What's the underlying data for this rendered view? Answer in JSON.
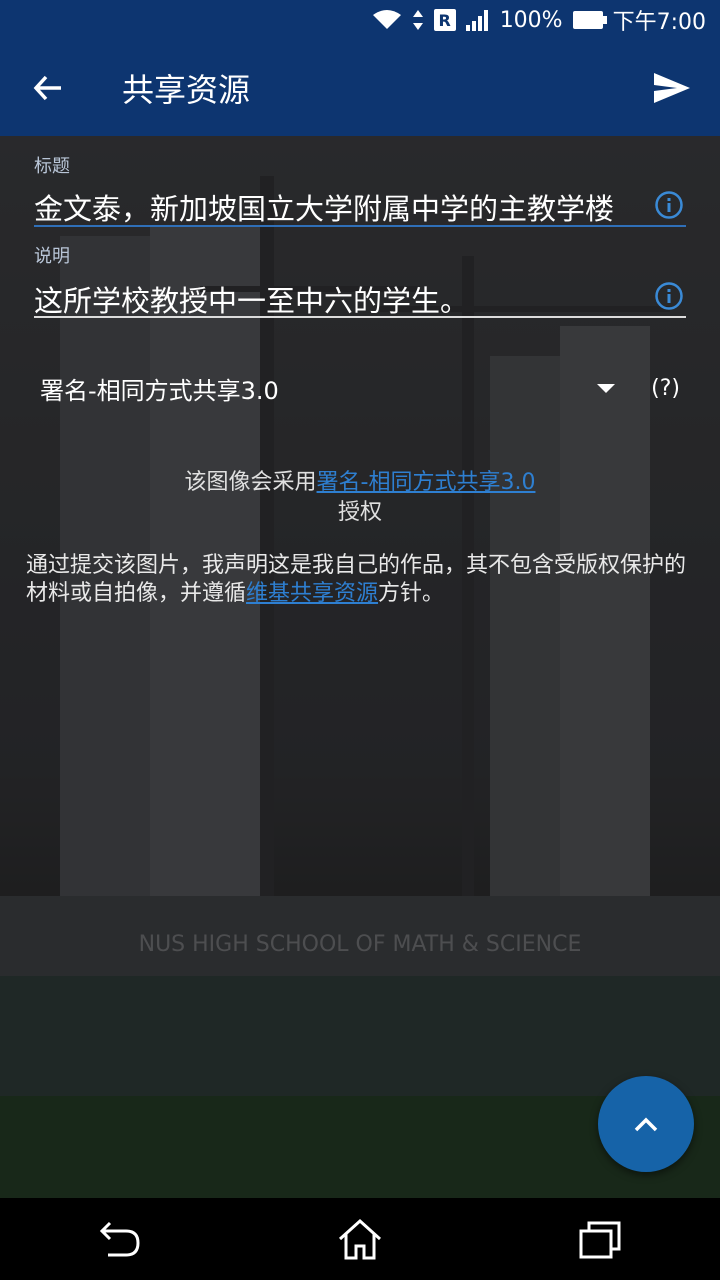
{
  "status_bar": {
    "carrier_badge": "R",
    "battery": "100%",
    "time": "下午7:00",
    "icons": [
      "wifi-icon",
      "data-arrows-icon",
      "signal-icon",
      "battery-icon"
    ]
  },
  "app_bar": {
    "title": "共享资源",
    "back_icon": "arrow-back-icon",
    "send_icon": "send-icon"
  },
  "form": {
    "title_label": "标题",
    "title_value": "金文泰，新加坡国立大学附属中学的主教学楼",
    "description_label": "说明",
    "description_value": "这所学校教授中一至中六的学生。",
    "license_selected": "署名-相同方式共享3.0",
    "help": "(?)"
  },
  "license_note": {
    "prefix": "该图像会采用",
    "link": "署名-相同方式共享3.0",
    "suffix": "授权"
  },
  "declaration": {
    "text": "通过提交该图片，我声明这是我自己的作品，其不包含受版权保护的材料或自拍像，并遵循",
    "link": "维基共享资源",
    "suffix": "方针。"
  },
  "background_sign": "NUS HIGH SCHOOL OF MATH & SCIENCE",
  "colors": {
    "primary": "#0d3570",
    "accent": "#1663a8",
    "link": "#2e7fd1"
  }
}
